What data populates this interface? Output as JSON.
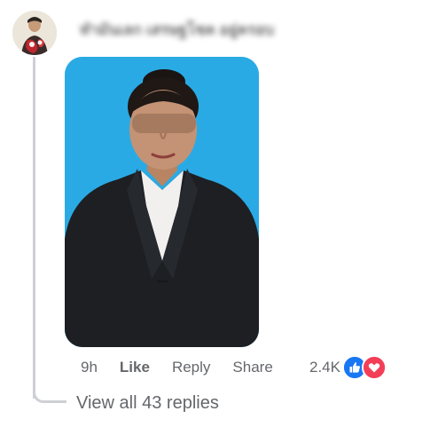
{
  "comment": {
    "author": "ทำมันเลก เสรษฐโชค อยู่ครอบ",
    "avatar_icon": "profile-avatar",
    "photo": {
      "background_color": "#2aaae4"
    },
    "actions": {
      "time": "9h",
      "like_label": "Like",
      "reply_label": "Reply",
      "share_label": "Share"
    },
    "reactions": {
      "count": "2.4K",
      "icons": [
        "like-reaction-icon",
        "love-reaction-icon"
      ],
      "like_color": "#1877f2",
      "love_color": "#f33e58"
    },
    "replies": {
      "view_all_label": "View all 43 replies"
    }
  }
}
